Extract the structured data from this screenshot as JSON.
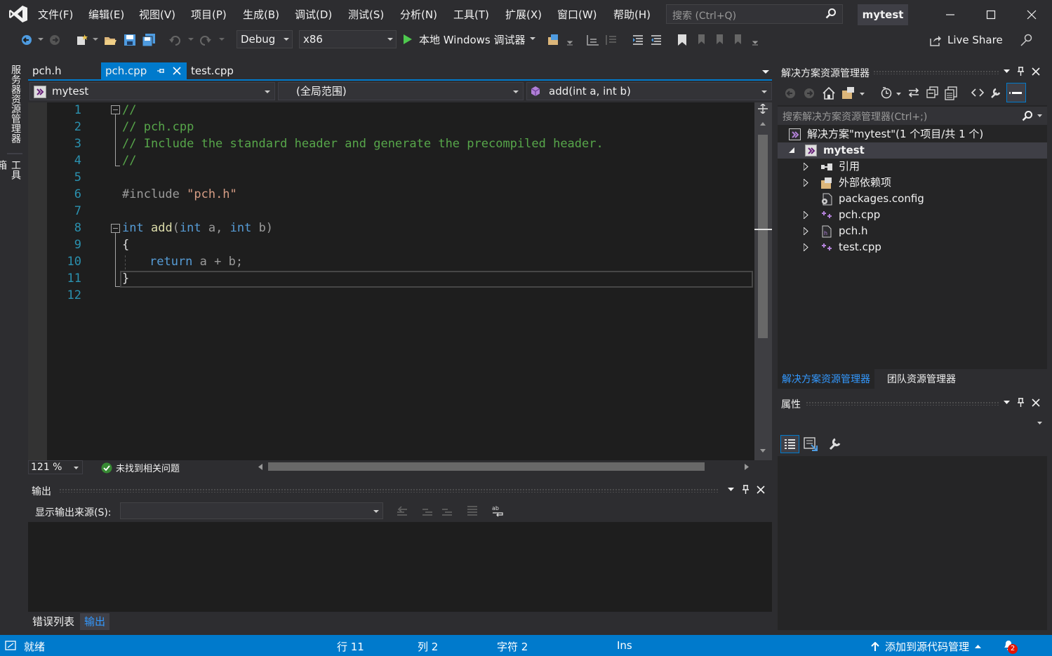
{
  "menu": {
    "items": [
      "文件(F)",
      "编辑(E)",
      "视图(V)",
      "项目(P)",
      "生成(B)",
      "调试(D)",
      "测试(S)",
      "分析(N)",
      "工具(T)",
      "扩展(X)",
      "窗口(W)",
      "帮助(H)"
    ],
    "search_placeholder": "搜索 (Ctrl+Q)",
    "solution_name": "mytest"
  },
  "toolbar": {
    "config": "Debug",
    "platform": "x86",
    "run_label": "本地 Windows 调试器",
    "live_share": "Live Share"
  },
  "left_strip": {
    "server_explorer": "服务器资源管理器",
    "toolbox": "工具箱"
  },
  "editor": {
    "tabs": [
      "pch.h",
      "pch.cpp",
      "test.cpp"
    ],
    "active_tab": "pch.cpp",
    "nav_project": "mytest",
    "nav_scope": "(全局范围)",
    "nav_member": "add(int a, int b)",
    "line_numbers": [
      "1",
      "2",
      "3",
      "4",
      "5",
      "6",
      "7",
      "8",
      "9",
      "10",
      "11",
      "12"
    ],
    "code": {
      "l1": "//",
      "l2": "// pch.cpp",
      "l3": "// Include the standard header and generate the precompiled header.",
      "l4": "//",
      "l6_dir": "#include ",
      "l6_str": "\"pch.h\"",
      "l8_kw1": "int",
      "l8_fn": "add",
      "l8_p1": "(",
      "l8_kw2": "int",
      "l8_a": " a, ",
      "l8_kw3": "int",
      "l8_b": " b)",
      "l9": "{",
      "l10_kw": "return",
      "l10_rest": " a + b;",
      "l11": "}"
    },
    "zoom": "121 %",
    "issues": "未找到相关问题"
  },
  "output": {
    "title": "输出",
    "source_label": "显示输出来源(S):",
    "source_value": ""
  },
  "bottom_tabs": [
    "错误列表",
    "输出"
  ],
  "solution_explorer": {
    "title": "解决方案资源管理器",
    "search_placeholder": "搜索解决方案资源管理器(Ctrl+;)",
    "solution_label": "解决方案\"mytest\"(1 个项目/共 1 个)",
    "project": "mytest",
    "items": [
      "引用",
      "外部依赖项",
      "packages.config",
      "pch.cpp",
      "pch.h",
      "test.cpp"
    ],
    "tabs": [
      "解决方案资源管理器",
      "团队资源管理器"
    ]
  },
  "properties": {
    "title": "属性"
  },
  "statusbar": {
    "ready": "就绪",
    "line": "行 11",
    "col": "列 2",
    "char": "字符 2",
    "mode": "Ins",
    "source_control": "添加到源代码管理",
    "notifications": "2"
  },
  "colors": {
    "accent": "#007acc",
    "background": "#2d2d30",
    "editor": "#1e1e1e",
    "comment": "#57a64a",
    "keyword": "#569cd6",
    "string": "#d69d85",
    "function": "#dcdcaa",
    "line_number": "#2b91af"
  }
}
